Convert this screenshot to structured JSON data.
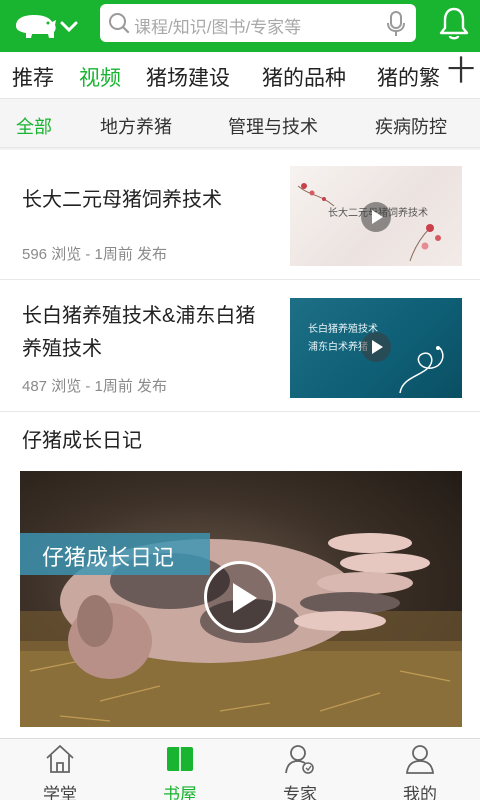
{
  "header": {
    "logo_icon": "pig-logo-icon",
    "dropdown_icon": "chevron-down-icon",
    "search": {
      "icon": "search-icon",
      "placeholder": "课程/知识/图书/专家等",
      "voice_icon": "microphone-icon"
    },
    "notification_icon": "bell-icon"
  },
  "category_tabs": {
    "items": [
      {
        "label": "推荐"
      },
      {
        "label": "视频"
      },
      {
        "label": "猪场建设"
      },
      {
        "label": "猪的品种"
      },
      {
        "label": "猪的繁"
      }
    ],
    "active_index": 1,
    "more_label": "十"
  },
  "sub_tabs": {
    "items": [
      {
        "label": "全部"
      },
      {
        "label": "地方养猪"
      },
      {
        "label": "管理与技术"
      },
      {
        "label": "疾病防控"
      }
    ],
    "active_index": 0
  },
  "feed": {
    "items": [
      {
        "title": "长大二元母猪饲养技术",
        "views": "596 浏览",
        "time": "1周前 发布",
        "thumb_text": "长大二元母猪饲养技术"
      },
      {
        "title": "长白猪养殖技术&浦东白猪养殖技术",
        "views": "487 浏览",
        "time": "1周前 发布",
        "thumb_line1": "长白猪养殖技术",
        "thumb_line2": "浦东白术养猪"
      }
    ],
    "video": {
      "title": "仔猪成长日记",
      "banner": "仔猪成长日记"
    },
    "meta_separator": " - "
  },
  "bottom_nav": {
    "items": [
      {
        "label": "学堂",
        "icon": "home-icon"
      },
      {
        "label": "书屋",
        "icon": "book-icon"
      },
      {
        "label": "专家",
        "icon": "expert-icon"
      },
      {
        "label": "我的",
        "icon": "user-icon"
      }
    ],
    "active_index": 1
  },
  "colors": {
    "brand": "#19b430",
    "text": "#222222",
    "meta": "#8a8a8a"
  }
}
